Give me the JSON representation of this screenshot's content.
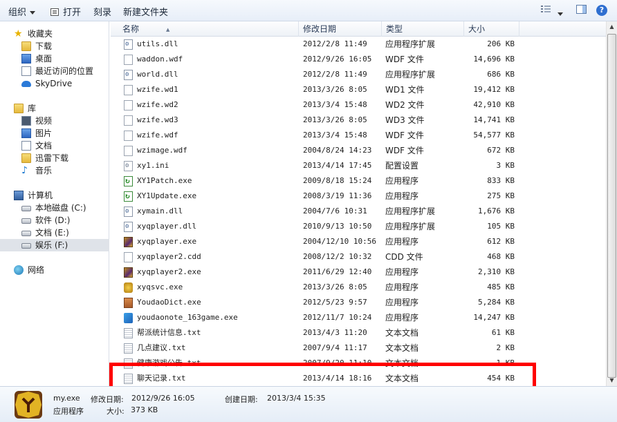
{
  "toolbar": {
    "organize": "组织",
    "open": "打开",
    "burn": "刻录",
    "new_folder": "新建文件夹"
  },
  "nav": {
    "favorites": "收藏夹",
    "downloads": "下载",
    "desktop": "桌面",
    "recent": "最近访问的位置",
    "skydrive": "SkyDrive",
    "libraries": "库",
    "videos": "视频",
    "pictures": "图片",
    "documents": "文档",
    "thunder": "迅雷下载",
    "music": "音乐",
    "computer": "计算机",
    "drive_c": "本地磁盘 (C:)",
    "drive_d": "软件 (D:)",
    "drive_e": "文档 (E:)",
    "drive_f": "娱乐 (F:)",
    "network": "网络"
  },
  "columns": {
    "name": "名称",
    "date": "修改日期",
    "type": "类型",
    "size": "大小"
  },
  "files": [
    {
      "name": "utils.dll",
      "date": "2012/2/8 11:49",
      "type": "应用程序扩展",
      "size": "206 KB",
      "icon": "dll"
    },
    {
      "name": "waddon.wdf",
      "date": "2012/9/26 16:05",
      "type": "WDF 文件",
      "size": "14,696 KB",
      "icon": "plain"
    },
    {
      "name": "world.dll",
      "date": "2012/2/8 11:49",
      "type": "应用程序扩展",
      "size": "686 KB",
      "icon": "dll"
    },
    {
      "name": "wzife.wd1",
      "date": "2013/3/26 8:05",
      "type": "WD1 文件",
      "size": "19,412 KB",
      "icon": "plain"
    },
    {
      "name": "wzife.wd2",
      "date": "2013/3/4 15:48",
      "type": "WD2 文件",
      "size": "42,910 KB",
      "icon": "plain"
    },
    {
      "name": "wzife.wd3",
      "date": "2013/3/26 8:05",
      "type": "WD3 文件",
      "size": "14,741 KB",
      "icon": "plain"
    },
    {
      "name": "wzife.wdf",
      "date": "2013/3/4 15:48",
      "type": "WDF 文件",
      "size": "54,577 KB",
      "icon": "plain"
    },
    {
      "name": "wzimage.wdf",
      "date": "2004/8/24 14:23",
      "type": "WDF 文件",
      "size": "672 KB",
      "icon": "plain"
    },
    {
      "name": "xy1.ini",
      "date": "2013/4/14 17:45",
      "type": "配置设置",
      "size": "3 KB",
      "icon": "ini"
    },
    {
      "name": "XY1Patch.exe",
      "date": "2009/8/18 15:24",
      "type": "应用程序",
      "size": "833 KB",
      "icon": "green"
    },
    {
      "name": "XY1Update.exe",
      "date": "2008/3/19 11:36",
      "type": "应用程序",
      "size": "275 KB",
      "icon": "green"
    },
    {
      "name": "xymain.dll",
      "date": "2004/7/6 10:31",
      "type": "应用程序扩展",
      "size": "1,676 KB",
      "icon": "dll"
    },
    {
      "name": "xyqplayer.dll",
      "date": "2010/9/13 10:50",
      "type": "应用程序扩展",
      "size": "105 KB",
      "icon": "dll"
    },
    {
      "name": "xyqplayer.exe",
      "date": "2004/12/10 10:56",
      "type": "应用程序",
      "size": "612 KB",
      "icon": "game"
    },
    {
      "name": "xyqplayer2.cdd",
      "date": "2008/12/2 10:32",
      "type": "CDD 文件",
      "size": "468 KB",
      "icon": "plain"
    },
    {
      "name": "xyqplayer2.exe",
      "date": "2011/6/29 12:40",
      "type": "应用程序",
      "size": "2,310 KB",
      "icon": "game"
    },
    {
      "name": "xyqsvc.exe",
      "date": "2013/3/26 8:05",
      "type": "应用程序",
      "size": "485 KB",
      "icon": "gold"
    },
    {
      "name": "YoudaoDict.exe",
      "date": "2012/5/23 9:57",
      "type": "应用程序",
      "size": "5,284 KB",
      "icon": "dict"
    },
    {
      "name": "youdaonote_163game.exe",
      "date": "2012/11/7 10:24",
      "type": "应用程序",
      "size": "14,247 KB",
      "icon": "note"
    },
    {
      "name": "帮派统计信息.txt",
      "date": "2013/4/3 11:20",
      "type": "文本文档",
      "size": "61 KB",
      "icon": "txt"
    },
    {
      "name": "几点建议.txt",
      "date": "2007/9/4 11:17",
      "type": "文本文档",
      "size": "2 KB",
      "icon": "txt"
    },
    {
      "name": "健康游戏公告.txt",
      "date": "2007/9/20 11:10",
      "type": "文本文档",
      "size": "1 KB",
      "icon": "txt"
    },
    {
      "name": "聊天记录.txt",
      "date": "2013/4/14 18:16",
      "type": "文本文档",
      "size": "454 KB",
      "icon": "txt"
    }
  ],
  "details": {
    "filename": "my.exe",
    "modified_label": "修改日期:",
    "modified_value": "2012/9/26 16:05",
    "created_label": "创建日期:",
    "created_value": "2013/3/4 15:35",
    "type": "应用程序",
    "size_label": "大小:",
    "size_value": "373 KB"
  },
  "colors": {
    "highlight": "#ff0000",
    "selected_nav": "#dfe3e9"
  }
}
